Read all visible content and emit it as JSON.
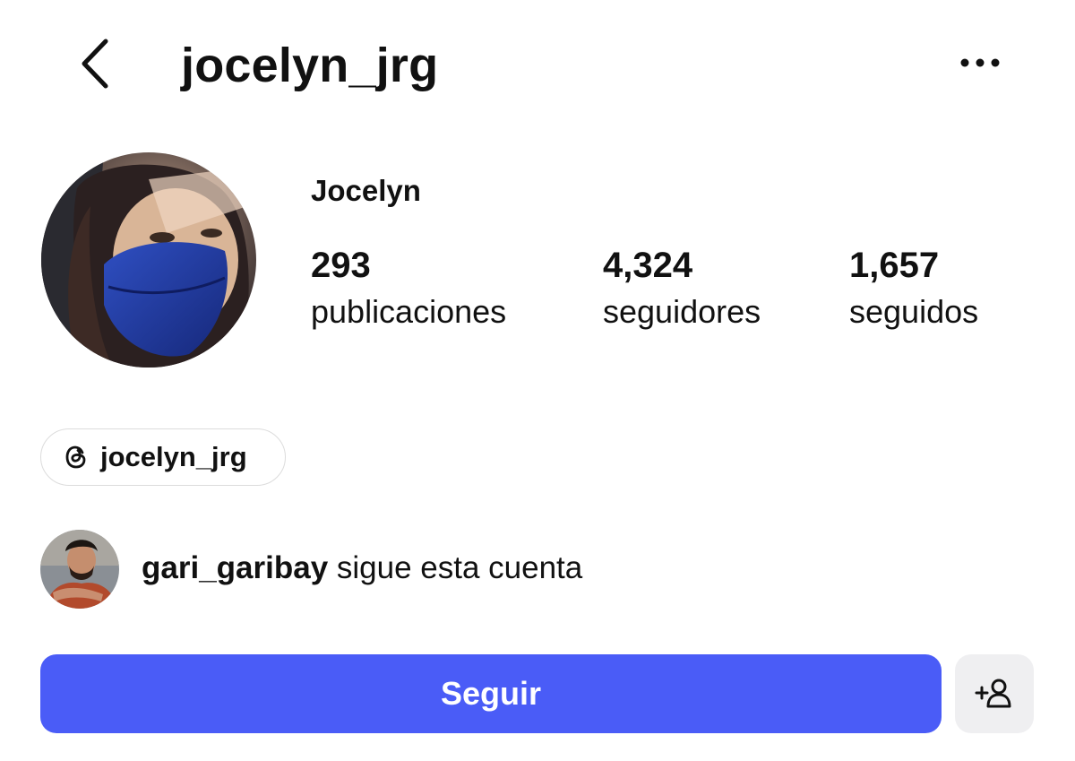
{
  "header": {
    "title": "jocelyn_jrg",
    "back_icon": "chevron-left-icon",
    "more_icon": "more-horizontal-icon"
  },
  "profile": {
    "display_name": "Jocelyn",
    "avatar": "profile-photo-woman-blue-mask",
    "stats": [
      {
        "value": "293",
        "label": "publicaciones"
      },
      {
        "value": "4,324",
        "label": "seguidores"
      },
      {
        "value": "1,657",
        "label": "seguidos"
      }
    ]
  },
  "threads_link": {
    "icon": "threads-icon",
    "handle": "jocelyn_jrg"
  },
  "mutual": {
    "avatar": "profile-photo-man",
    "username": "gari_garibay",
    "text": " sigue esta cuenta"
  },
  "actions": {
    "follow_label": "Seguir",
    "suggest_icon": "add-person-icon"
  },
  "colors": {
    "accent": "#4a5cf7",
    "secondary_button": "#efeff1",
    "text": "#111111"
  }
}
